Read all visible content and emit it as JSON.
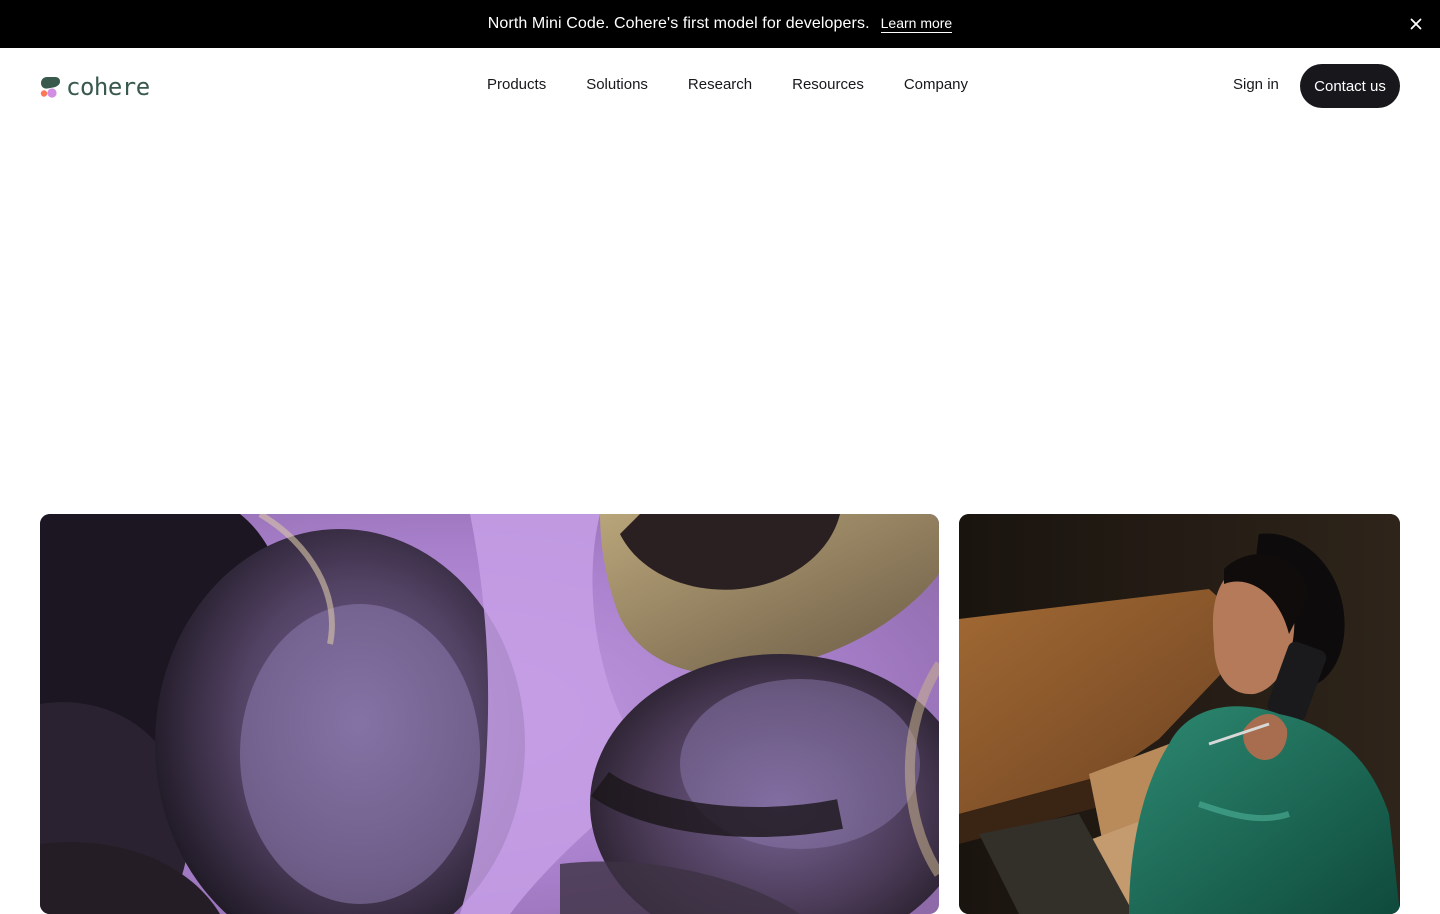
{
  "announcement": {
    "text": "North Mini Code. Cohere's first model for developers.",
    "link_label": "Learn more",
    "close_icon": "close-icon"
  },
  "header": {
    "logo": {
      "wordmark": "cohere",
      "icon": "cohere-logo-icon",
      "color": "#39594d"
    },
    "nav": [
      {
        "label": "Products"
      },
      {
        "label": "Solutions"
      },
      {
        "label": "Research"
      },
      {
        "label": "Resources"
      },
      {
        "label": "Company"
      }
    ],
    "sign_in_label": "Sign in",
    "contact_label": "Contact us"
  },
  "hero": {
    "left_image": "abstract-purple-glass-render",
    "right_image": "woman-on-phone-at-desk-photo"
  },
  "colors": {
    "announcement_bg": "#000000",
    "button_dark": "#17171c",
    "brand_green": "#39594d",
    "accent_purple": "#b592d6",
    "accent_coral": "#ff7759"
  }
}
